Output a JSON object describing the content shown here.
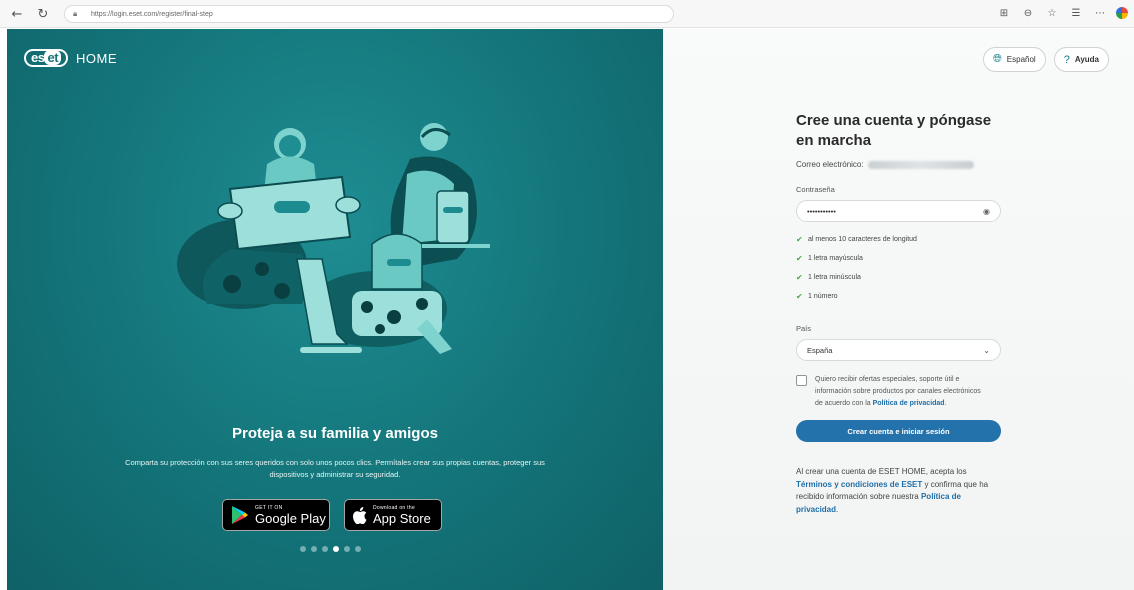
{
  "browser": {
    "url": "https://login.eset.com/register/final-step"
  },
  "hero": {
    "logo_text": "HOME",
    "title": "Proteja a su familia y amigos",
    "description": "Comparta su protección con sus seres queridos con solo unos pocos clics. Permítales crear sus propias cuentas, proteger sus dispositivos y administrar su seguridad.",
    "google_play": {
      "small": "GET IT ON",
      "big": "Google Play"
    },
    "app_store": {
      "small": "Download on the",
      "big": "App Store"
    },
    "carousel": {
      "count": 6,
      "active_index": 3
    }
  },
  "header": {
    "language_label": "Español",
    "help_label": "Ayuda"
  },
  "form": {
    "title": "Cree una cuenta y póngase en marcha",
    "email_label": "Correo electrónico:",
    "password_label": "Contraseña",
    "password_value": "•••••••••••",
    "requirements": [
      "al menos 10 caracteres de longitud",
      "1 letra mayúscula",
      "1 letra minúscula",
      "1 número"
    ],
    "country_label": "País",
    "country_value": "España",
    "consent_text": "Quiero recibir ofertas especiales, soporte útil e información sobre productos por canales electrónicos de acuerdo con la",
    "consent_link": "Política de privacidad",
    "consent_end": ".",
    "submit_label": "Crear cuenta e iniciar sesión",
    "legal_1": "Al crear una cuenta de ESET HOME, acepta los",
    "legal_link_1": "Términos y condiciones de ESET",
    "legal_2": "y confirma que ha recibido información sobre nuestra",
    "legal_link_2": "Política de privacidad",
    "legal_end": "."
  },
  "colors": {
    "brand_teal": "#147479",
    "primary_blue": "#2372ab",
    "check_green": "#4aa84f"
  }
}
